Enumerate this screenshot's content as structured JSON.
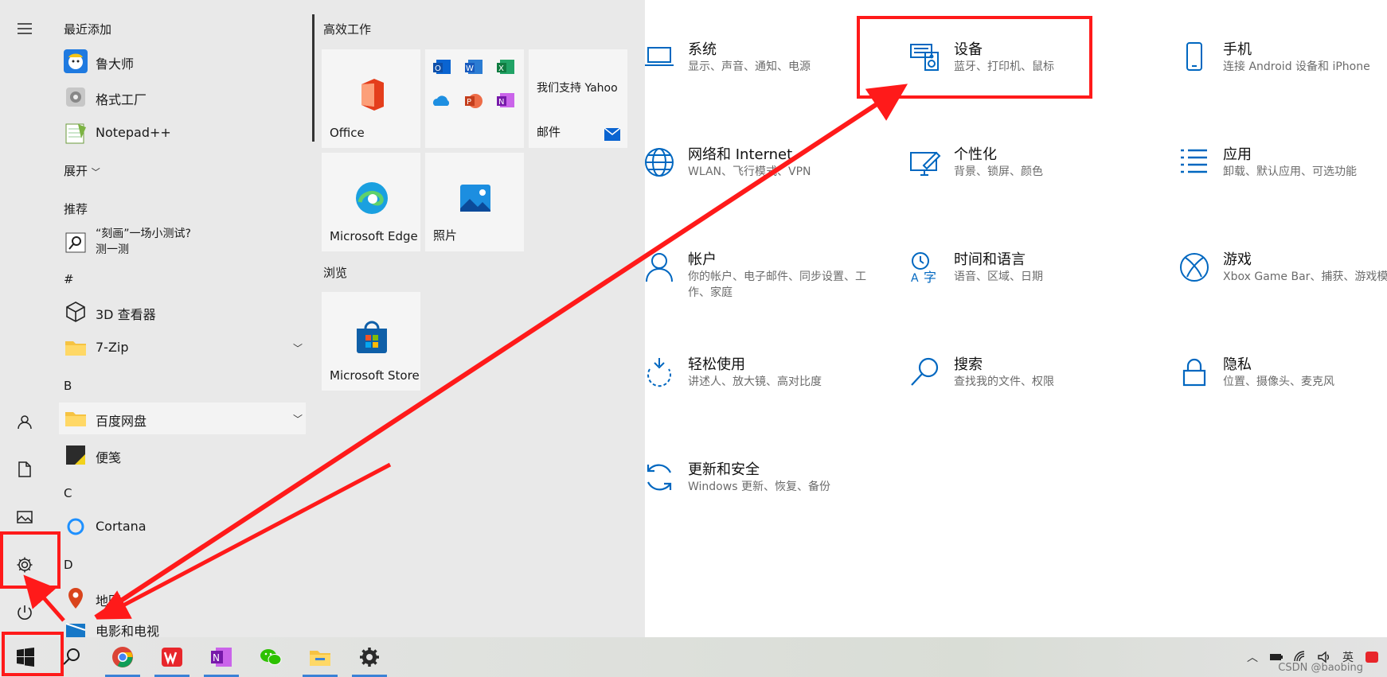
{
  "settings": {
    "items": [
      {
        "title": "系统",
        "desc": "显示、声音、通知、电源"
      },
      {
        "title": "设备",
        "desc": "蓝牙、打印机、鼠标"
      },
      {
        "title": "手机",
        "desc": "连接 Android 设备和 iPhone"
      },
      {
        "title": "网络和 Internet",
        "desc": "WLAN、飞行模式、VPN"
      },
      {
        "title": "个性化",
        "desc": "背景、锁屏、颜色"
      },
      {
        "title": "应用",
        "desc": "卸载、默认应用、可选功能"
      },
      {
        "title": "帐户",
        "desc": "你的帐户、电子邮件、同步设置、工作、家庭"
      },
      {
        "title": "时间和语言",
        "desc": "语音、区域、日期"
      },
      {
        "title": "游戏",
        "desc": "Xbox Game Bar、捕获、游戏模式"
      },
      {
        "title": "轻松使用",
        "desc": "讲述人、放大镜、高对比度"
      },
      {
        "title": "搜索",
        "desc": "查找我的文件、权限"
      },
      {
        "title": "隐私",
        "desc": "位置、摄像头、麦克风"
      },
      {
        "title": "更新和安全",
        "desc": "Windows 更新、恢复、备份"
      }
    ]
  },
  "start": {
    "recent_header": "最近添加",
    "recent": [
      {
        "name": "鲁大师",
        "icon": "ludashi-icon"
      },
      {
        "name": "格式工厂",
        "icon": "format-factory-icon"
      },
      {
        "name": "Notepad++",
        "icon": "notepadpp-icon"
      }
    ],
    "expand_label": "展开",
    "recommend_header": "推荐",
    "recommend_line1": "“刻画”一场小测试?",
    "recommend_line2": "测一测",
    "letters": {
      "hash": "#",
      "b": "B",
      "c": "C",
      "d": "D"
    },
    "apps": {
      "viewer3d": "3D 查看器",
      "zip": "7-Zip",
      "baidu": "百度网盘",
      "sticky": "便笺",
      "cortana": "Cortana",
      "maps": "地图",
      "movies": "电影和电视"
    },
    "groups": {
      "productivity": "高效工作",
      "browse": "浏览"
    },
    "tiles": {
      "office": "Office",
      "yahoo": "我们支持 Yahoo",
      "mail": "邮件",
      "edge": "Microsoft Edge",
      "photos": "照片",
      "store": "Microsoft Store"
    }
  },
  "taskbar": {
    "watermark": "CSDN @baobing",
    "tray_char": "英"
  },
  "colors": {
    "accent": "#0067c0",
    "annotation_red": "#ff1a1a"
  }
}
